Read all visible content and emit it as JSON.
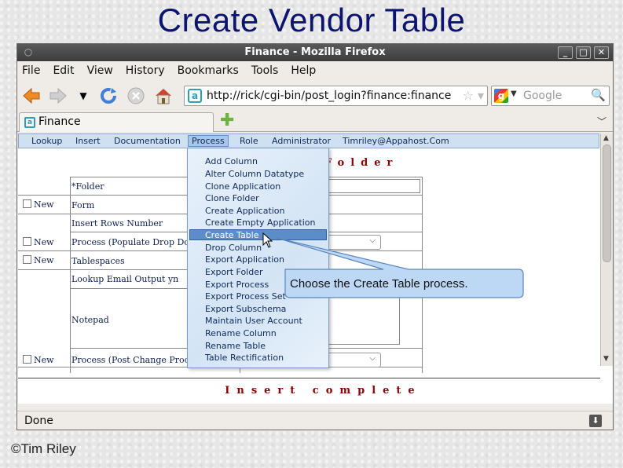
{
  "slide": {
    "title": "Create Vendor Table",
    "credit": "©Tim Riley"
  },
  "window": {
    "title": "Finance - Mozilla Firefox",
    "controls": {
      "minimize": "_",
      "maximize": "□",
      "close": "✕"
    }
  },
  "menubar": [
    "File",
    "Edit",
    "View",
    "History",
    "Bookmarks",
    "Tools",
    "Help"
  ],
  "navbar": {
    "url": "http://rick/cgi-bin/post_login?finance:finance",
    "search_placeholder": "Google"
  },
  "tab": {
    "label": "Finance"
  },
  "appmenu": {
    "items": [
      "Lookup",
      "Insert",
      "Documentation",
      "Process",
      "Role",
      "Administrator",
      "Timriley@Appahost.Com"
    ],
    "active": "Process"
  },
  "form": {
    "title": "Folder",
    "fields": [
      "*Folder",
      "Form",
      "Insert Rows Number",
      "Process (Populate Drop Do",
      "Tablespaces",
      "Lookup Email Output yn",
      "Notepad",
      "Process (Post Change Proc"
    ],
    "new_label": "New",
    "insert_status": "Insert complete"
  },
  "process_menu": {
    "items": [
      "Add Column",
      "Alter Column Datatype",
      "Clone Application",
      "Clone Folder",
      "Create Application",
      "Create Empty Application",
      "Create Table",
      "Drop Column",
      "Export Application",
      "Export Folder",
      "Export Process",
      "Export Process Set",
      "Export Subschema",
      "Maintain User Account",
      "Rename Column",
      "Rename Table",
      "Table Rectification"
    ],
    "selected": "Create Table"
  },
  "callout": {
    "text": "Choose the Create Table process."
  },
  "status": {
    "text": "Done"
  },
  "icons": {
    "back": "back-arrow-icon",
    "forward": "forward-arrow-icon",
    "reload": "reload-icon",
    "stop": "stop-icon",
    "home": "home-icon",
    "star": "bookmark-star-icon",
    "search": "search-icon",
    "new_tab": "new-tab-plus-icon",
    "download": "download-icon"
  },
  "colors": {
    "title": "#0b1470",
    "accent_red": "#8b0000",
    "menu_bg": "#cfe0f2",
    "callout_bg": "#bcd8f5",
    "highlight": "#5d8dc9"
  }
}
